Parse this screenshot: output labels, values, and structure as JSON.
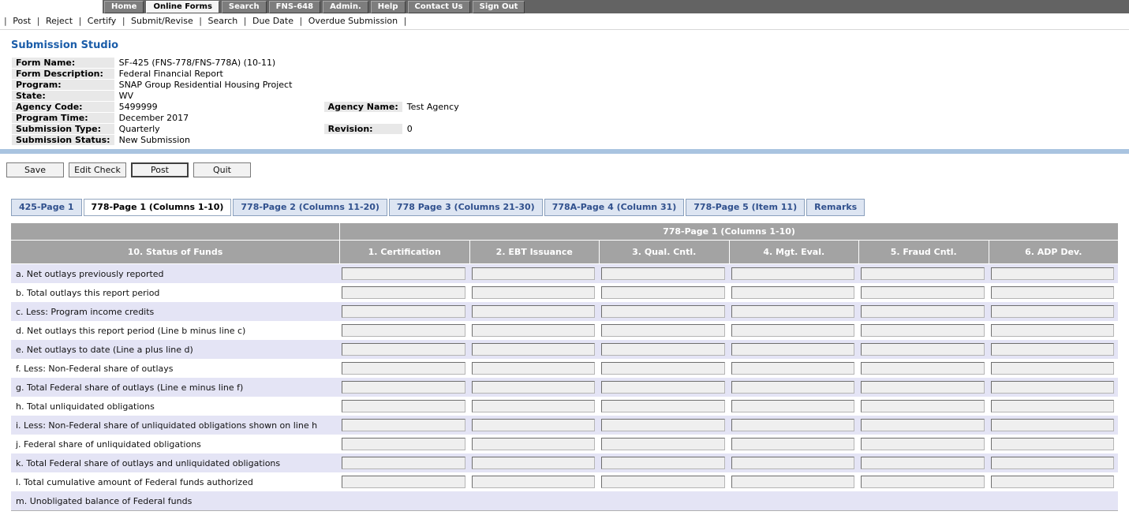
{
  "nav": {
    "items": [
      {
        "label": "Home",
        "active": false
      },
      {
        "label": "Online Forms",
        "active": true
      },
      {
        "label": "Search",
        "active": false
      },
      {
        "label": "FNS-648",
        "active": false
      },
      {
        "label": "Admin.",
        "active": false
      },
      {
        "label": "Help",
        "active": false
      },
      {
        "label": "Contact Us",
        "active": false
      },
      {
        "label": "Sign Out",
        "active": false
      }
    ]
  },
  "toolbar": {
    "separator": "|",
    "links": [
      "Post",
      "Reject",
      "Certify",
      "Submit/Revise",
      "Search",
      "Due Date",
      "Overdue Submission"
    ]
  },
  "page_title": "Submission Studio",
  "form_info": {
    "rows": [
      {
        "label": "Form Name:",
        "value": "SF-425 (FNS-778/FNS-778A) (10-11)"
      },
      {
        "label": "Form Description:",
        "value": "Federal Financial Report"
      },
      {
        "label": "Program:",
        "value": "SNAP Group Residential Housing Project"
      },
      {
        "label": "State:",
        "value": "WV"
      },
      {
        "label": "Agency Code:",
        "value": "5499999",
        "label2": "Agency Name:",
        "value2": "Test Agency"
      },
      {
        "label": "Program Time:",
        "value": "December 2017"
      },
      {
        "label": "Submission Type:",
        "value": "Quarterly",
        "label2": "Revision:",
        "value2": "0"
      },
      {
        "label": "Submission Status:",
        "value": "New Submission"
      }
    ]
  },
  "actions": {
    "save": "Save",
    "edit_check": "Edit Check",
    "post": "Post",
    "quit": "Quit"
  },
  "tabs": [
    {
      "label": "425-Page 1",
      "active": false
    },
    {
      "label": "778-Page 1 (Columns 1-10)",
      "active": true
    },
    {
      "label": "778-Page 2 (Columns 11-20)",
      "active": false
    },
    {
      "label": "778 Page 3 (Columns 21-30)",
      "active": false
    },
    {
      "label": "778A-Page 4 (Column 31)",
      "active": false
    },
    {
      "label": "778-Page 5 (Item 11)",
      "active": false
    },
    {
      "label": "Remarks",
      "active": false
    }
  ],
  "grid": {
    "group_header": "778-Page 1 (Columns 1-10)",
    "columns": [
      "10. Status of Funds",
      "1. Certification",
      "2. EBT Issuance",
      "3. Qual. Cntl.",
      "4. Mgt. Eval.",
      "5. Fraud Cntl.",
      "6. ADP Dev."
    ],
    "input_default_value": "",
    "rows": [
      {
        "label": "a. Net outlays previously reported",
        "has_inputs": true
      },
      {
        "label": "b. Total outlays this report period",
        "has_inputs": true
      },
      {
        "label": "c. Less: Program income credits",
        "has_inputs": true
      },
      {
        "label": "d. Net outlays this report period (Line b minus line c)",
        "has_inputs": true
      },
      {
        "label": "e. Net outlays to date (Line a plus line d)",
        "has_inputs": true
      },
      {
        "label": "f. Less: Non-Federal share of outlays",
        "has_inputs": true
      },
      {
        "label": "g. Total Federal share of outlays (Line e minus line f)",
        "has_inputs": true
      },
      {
        "label": "h. Total unliquidated obligations",
        "has_inputs": true
      },
      {
        "label": "i. Less: Non-Federal share of unliquidated obligations shown on line h",
        "has_inputs": true
      },
      {
        "label": "j. Federal share of unliquidated obligations",
        "has_inputs": true
      },
      {
        "label": "k. Total Federal share of outlays and unliquidated obligations",
        "has_inputs": true
      },
      {
        "label": "l. Total cumulative amount of Federal funds authorized",
        "has_inputs": true
      },
      {
        "label": "m. Unobligated balance of Federal funds",
        "has_inputs": false
      }
    ]
  },
  "colors": {
    "title_blue": "#1b5da9",
    "nav_bar_gray": "#636363",
    "header_gray": "#a3a3a3",
    "row_alt_lavender": "#e4e4f5",
    "divider_blue": "#a9c4e0",
    "tab_inactive_bg": "#dde5f2",
    "tab_text_blue": "#30508d",
    "label_cell_gray": "#e8e8e8"
  }
}
